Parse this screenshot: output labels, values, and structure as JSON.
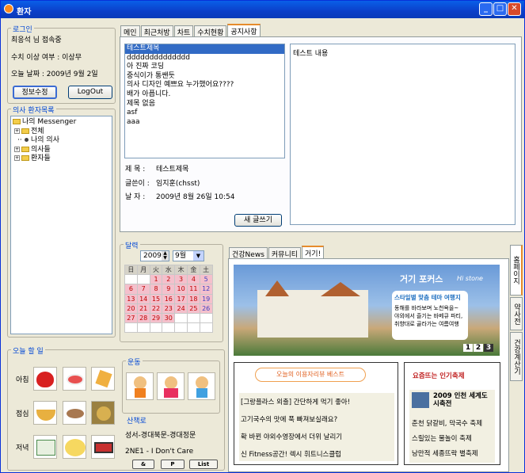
{
  "window": {
    "title": "환자"
  },
  "login": {
    "title": "로그인",
    "welcome": "최응석 님 접속중",
    "status": "수치 이상 여부 : 이상무",
    "date": "오늘 날짜 : 2009년 9월 2일",
    "edit_button": "정보수정",
    "logout_button": "LogOut"
  },
  "patients": {
    "title": "의사 환자목록",
    "tree": [
      "나의 Messenger",
      "전체",
      "나의 의사",
      "의사들",
      "환자들"
    ]
  },
  "today": {
    "title": "오늘 할 일",
    "meals": [
      "아침",
      "점심",
      "저녁"
    ],
    "exercise_title": "운동",
    "walk_title": "산책로",
    "walk_route": "성서-경대북문-경대정문",
    "music": "2NE1 - I Don't Care",
    "buttons": [
      "&",
      "P",
      "List"
    ]
  },
  "tabs": [
    "메인",
    "최근처방",
    "차트",
    "수치현황",
    "공지사항"
  ],
  "notice": {
    "items": [
      "테스트제목",
      "dddddddddddddd",
      "아 진짜 코딩",
      "중식이가 통쌘듯",
      "의사 디자인 예쁘요 누가했어요????",
      "배가 아픕니다.",
      "제목 없음",
      "asf",
      "aaa"
    ],
    "subject_label": "제 목 :",
    "subject": "테스트제목",
    "author_label": "글쓴이 :",
    "author": "임지훈(chsst)",
    "date_label": "날 자 :",
    "date": "2009년 8월 26일 10:54",
    "content": "테스트 내용",
    "write_button": "새 글쓰기"
  },
  "calendar": {
    "title": "달력",
    "year": "2009",
    "month": "9월",
    "weekdays": [
      "日",
      "月",
      "火",
      "水",
      "木",
      "金",
      "土"
    ],
    "rows": [
      [
        "",
        "",
        "1",
        "2",
        "3",
        "4",
        "5"
      ],
      [
        "6",
        "7",
        "8",
        "9",
        "10",
        "11",
        "12"
      ],
      [
        "13",
        "14",
        "15",
        "16",
        "17",
        "18",
        "19"
      ],
      [
        "20",
        "21",
        "22",
        "23",
        "24",
        "25",
        "26"
      ],
      [
        "27",
        "28",
        "29",
        "30",
        "",
        "",
        ""
      ],
      [
        "",
        "",
        "",
        "",
        "",
        "",
        ""
      ]
    ]
  },
  "web": {
    "tabs": [
      "건강News",
      "커뮤니티",
      "거기!"
    ],
    "side_tabs": [
      "홈페이지",
      "약사전",
      "건강계산기"
    ],
    "banner_title": "거기 포커스",
    "banner_sub": "Hi stone",
    "banner_box_title": "스타일별 맞춤 테마 여행지",
    "banner_box_text": "동해를 바라보며 노천욕을~\n야외에서 즐기는 바베큐 파티,\n취향대로 골라가는 여름여행",
    "pages": [
      "1",
      "2",
      "3"
    ],
    "left_title": "오늘의 이용자리뷰 베스트",
    "left_items": [
      "[그랑플라스 외출] 간단하게 먹기 좋아!",
      "고기국수의 맛에 푹 빠져보실래요?",
      "확 바뀐 야외수영장에서 더위 날리기",
      "신 Fitness공간! 렉시 휘트니스클럽"
    ],
    "right_title": "요즘뜨는 인기축제",
    "right_feature": "2009 인천 세계도시축전",
    "right_items": [
      "춘천 닭갈비, 막국수 축제",
      "스릴있는 물놀이 축제",
      "낭만적 세종뜨락 별축제"
    ]
  },
  "colors": {
    "accent": "#0046d5",
    "tab_highlight": "#e68b2c",
    "selection": "#316ac5"
  }
}
